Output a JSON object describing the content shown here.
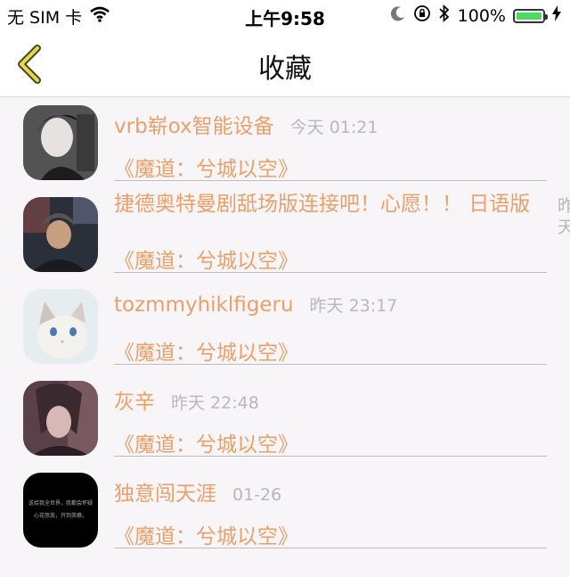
{
  "status_bar": {
    "carrier": "无 SIM 卡",
    "time": "上午9:58",
    "battery": "100%",
    "icons": [
      "wifi-icon",
      "moon-icon",
      "orientation-lock-icon",
      "bluetooth-icon",
      "battery-icon",
      "charging-icon"
    ]
  },
  "nav": {
    "title": "收藏",
    "back_icon": "chevron-left-icon"
  },
  "colors": {
    "accent": "#e9a06a",
    "time_text": "#b8b8b8"
  },
  "favorites": [
    {
      "name": "vrb崭ox智能设备",
      "time": "今天 01:21",
      "work": "《魔道：兮城以空》"
    },
    {
      "name": "捷德奥特曼剧舐场版连接吧！心愿！！ 日语版",
      "time": "昨天",
      "work": "《魔道：兮城以空》"
    },
    {
      "name": "tozmmyhiklfigeru",
      "time": "昨天 23:17",
      "work": "《魔道：兮城以空》"
    },
    {
      "name": "灰辛",
      "time": "昨天 22:48",
      "work": "《魔道：兮城以空》"
    },
    {
      "name": "独意闯天涯",
      "time": "01-26",
      "work": "《魔道：兮城以空》"
    }
  ],
  "avatar_5_caption": "送给我全世界，我都会怀疑 心花怒放，开到荼靡。"
}
